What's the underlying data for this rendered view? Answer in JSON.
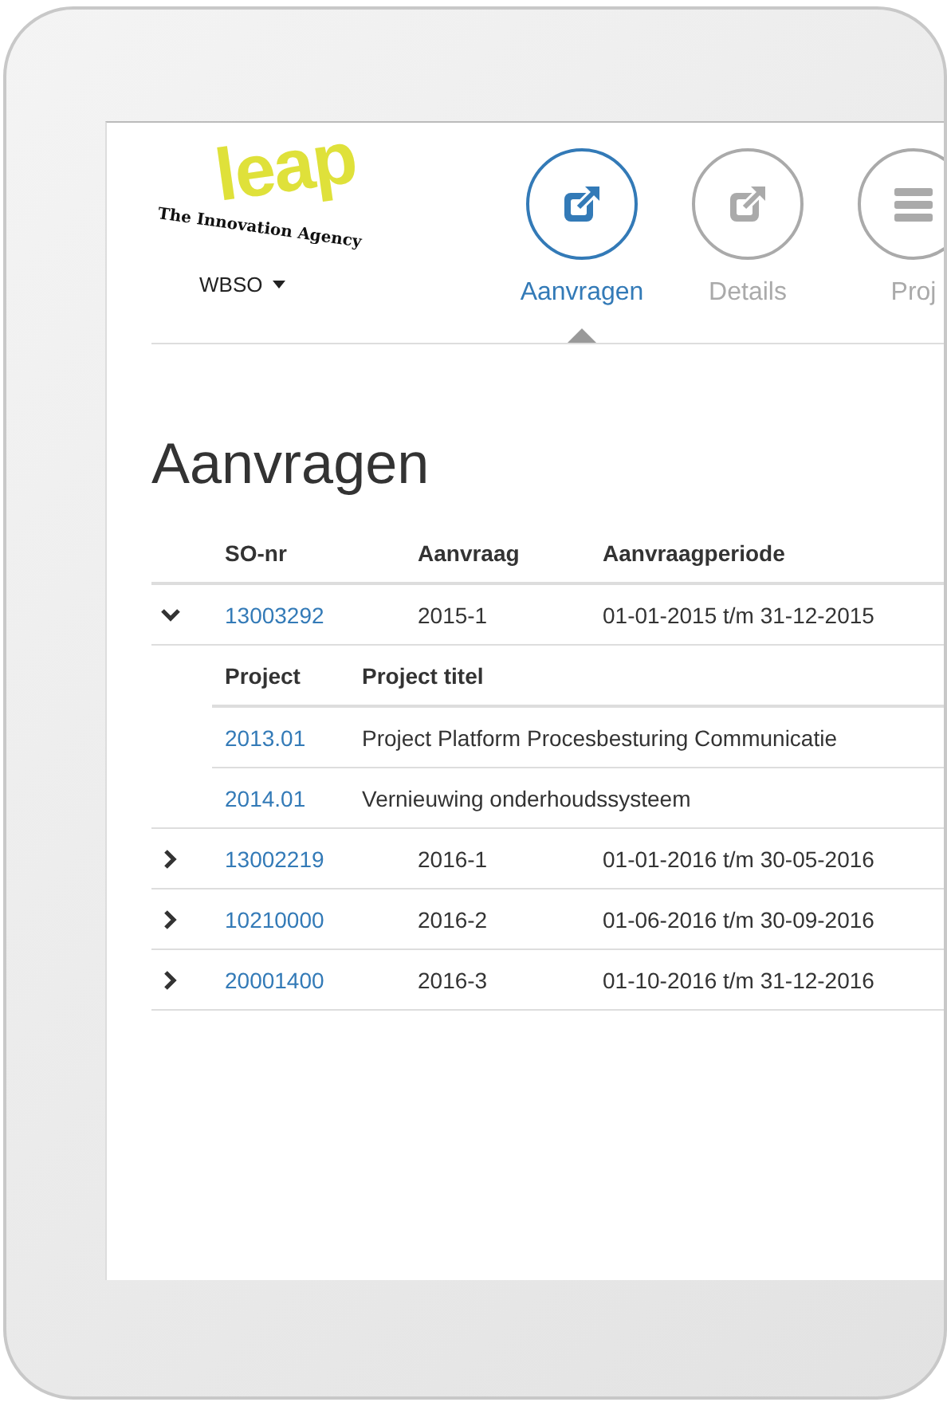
{
  "brand": {
    "logo_word": "leap",
    "tagline": "The Innovation Agency"
  },
  "program_menu": {
    "label": "WBSO"
  },
  "steps": [
    {
      "label": "Aanvragen",
      "selected": true,
      "kind": "edit"
    },
    {
      "label": "Details",
      "selected": false,
      "kind": "edit"
    },
    {
      "label": "Proj",
      "selected": false,
      "kind": "list"
    }
  ],
  "heading": "Aanvragen",
  "table": {
    "columns": [
      "SO-nr",
      "Aanvraag",
      "Aanvraagperiode"
    ],
    "rows": [
      {
        "so_nr": "13003292",
        "aanvraag": "2015-1",
        "periode": "01-01-2015 t/m 31-12-2015",
        "expanded": true,
        "projects": {
          "columns": [
            "Project",
            "Project titel"
          ],
          "rows": [
            {
              "project": "2013.01",
              "titel": "Project Platform Procesbesturing Communicatie"
            },
            {
              "project": "2014.01",
              "titel": "Vernieuwing onderhoudssysteem"
            }
          ]
        }
      },
      {
        "so_nr": "13002219",
        "aanvraag": "2016-1",
        "periode": "01-01-2016 t/m 30-05-2016",
        "expanded": false
      },
      {
        "so_nr": "10210000",
        "aanvraag": "2016-2",
        "periode": "01-06-2016 t/m 30-09-2016",
        "expanded": false
      },
      {
        "so_nr": "20001400",
        "aanvraag": "2016-3",
        "periode": "01-10-2016 t/m 31-12-2016",
        "expanded": false
      }
    ]
  }
}
